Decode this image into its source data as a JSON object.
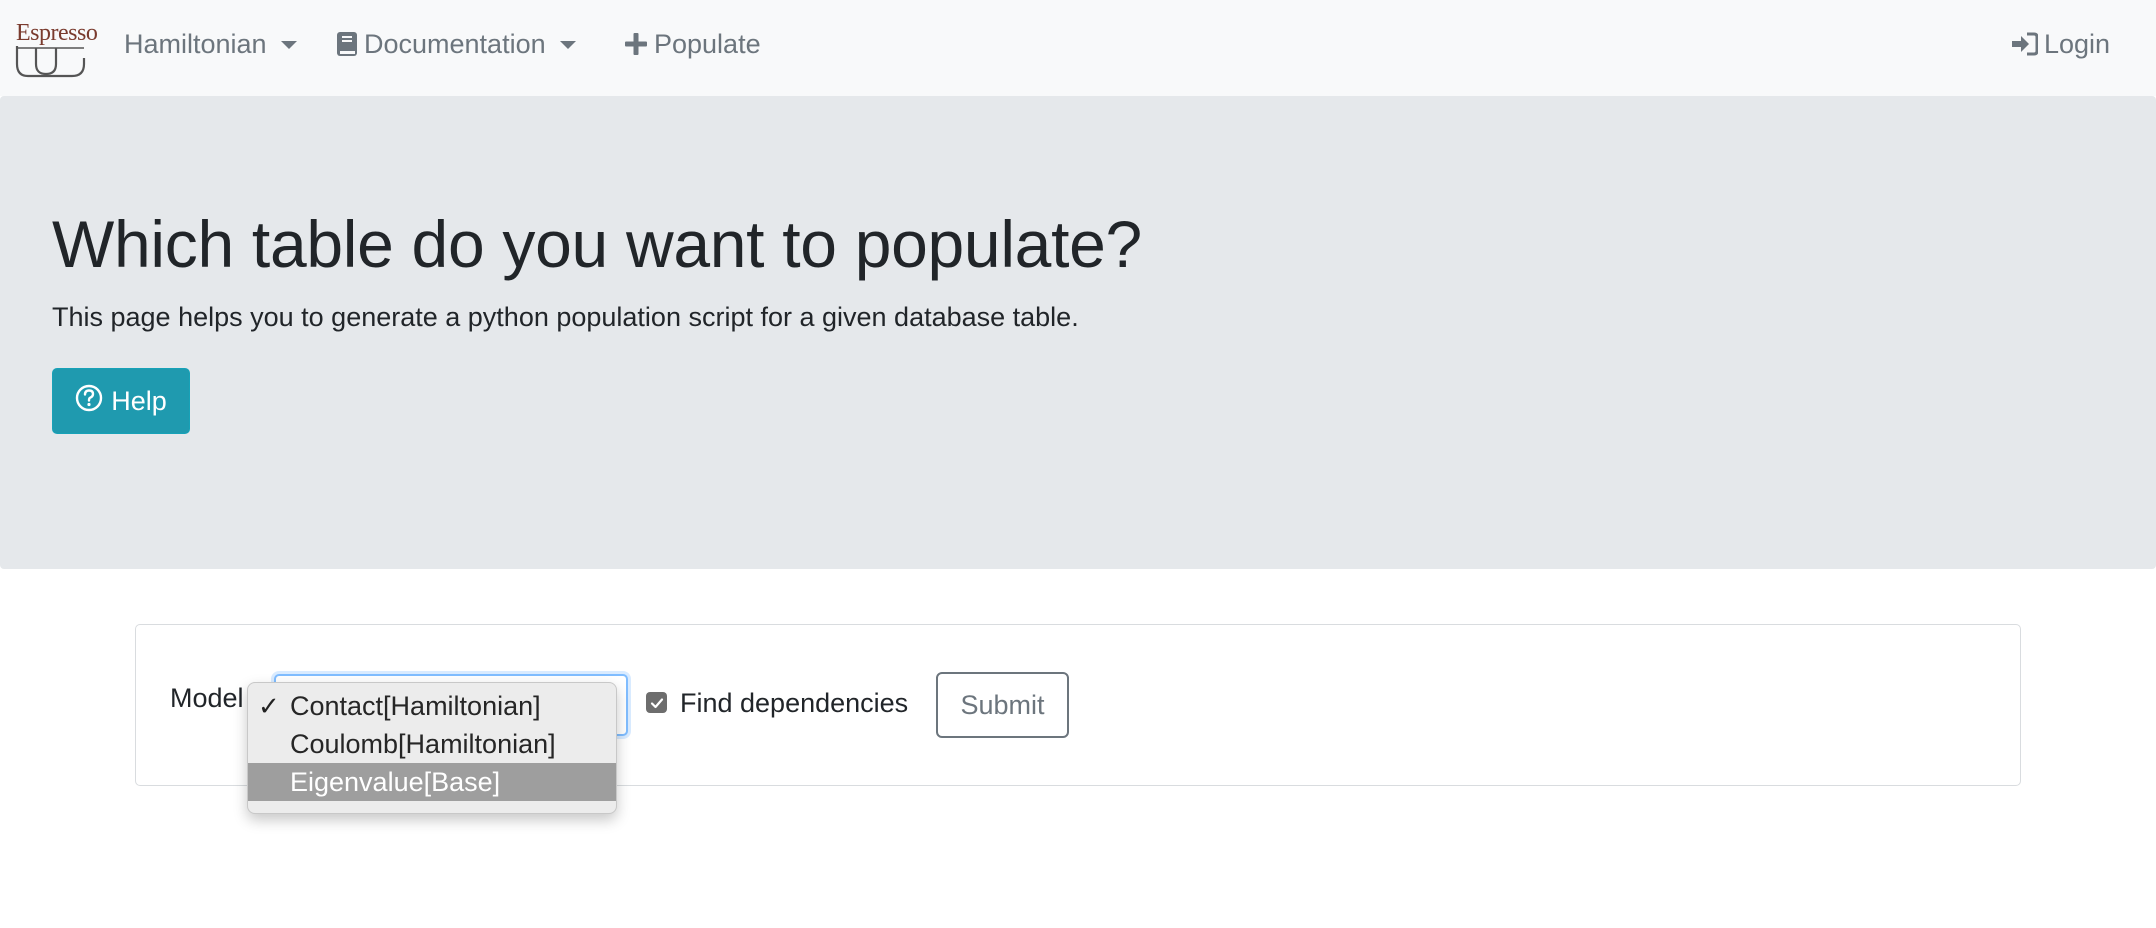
{
  "navbar": {
    "brand_text": "Espresso",
    "hamiltonian": "Hamiltonian",
    "documentation": "Documentation",
    "populate": "Populate",
    "login": "Login"
  },
  "jumbotron": {
    "title": "Which table do you want to populate?",
    "lead": "This page helps you to generate a python population script for a given database table.",
    "help_label": "Help"
  },
  "form": {
    "model_label": "Model",
    "find_dependencies_label": "Find dependencies",
    "find_dependencies_checked": true,
    "submit_label": "Submit",
    "model_options": [
      {
        "label": "Contact[Hamiltonian]",
        "selected": true
      },
      {
        "label": "Coulomb[Hamiltonian]",
        "selected": false
      },
      {
        "label": "Eigenvalue[Base]",
        "selected": false,
        "highlighted": true
      }
    ]
  },
  "colors": {
    "navbar_bg": "#f8f9fa",
    "jumbotron_bg": "#e5e8eb",
    "help_button": "#1f9aaf",
    "brand": "#7a3b2e",
    "focus_border": "#80bdff"
  }
}
